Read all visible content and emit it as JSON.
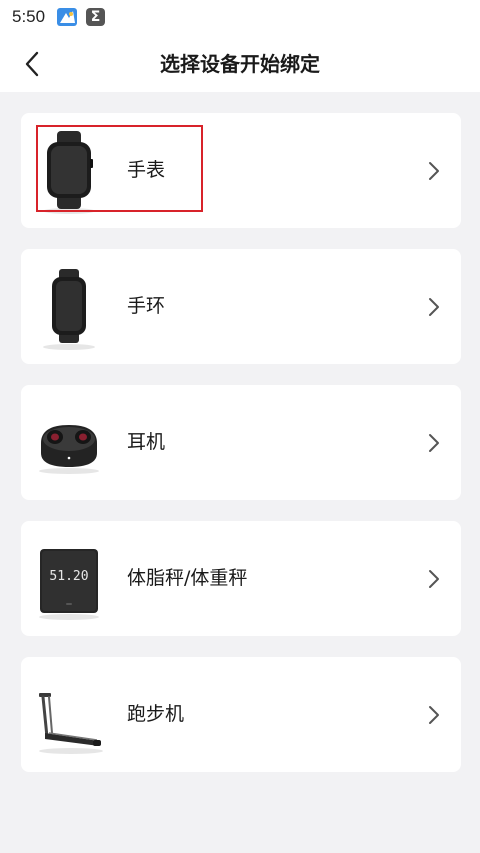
{
  "status_bar": {
    "time": "5:50",
    "icons": [
      "app-icon",
      "sigma-icon"
    ],
    "sigma_glyph": "Σ"
  },
  "header": {
    "title": "选择设备开始绑定",
    "back_icon": "back-arrow-icon"
  },
  "devices": [
    {
      "label": "手表",
      "icon": "smartwatch-icon"
    },
    {
      "label": "手环",
      "icon": "fitness-band-icon"
    },
    {
      "label": "耳机",
      "icon": "earbuds-icon"
    },
    {
      "label": "体脂秤/体重秤",
      "icon": "scale-icon",
      "display": "51.20"
    },
    {
      "label": "跑步机",
      "icon": "treadmill-icon"
    }
  ],
  "colors": {
    "background": "#f2f2f4",
    "card": "#ffffff",
    "highlight": "#d8232a",
    "text": "#1a1a1a"
  }
}
